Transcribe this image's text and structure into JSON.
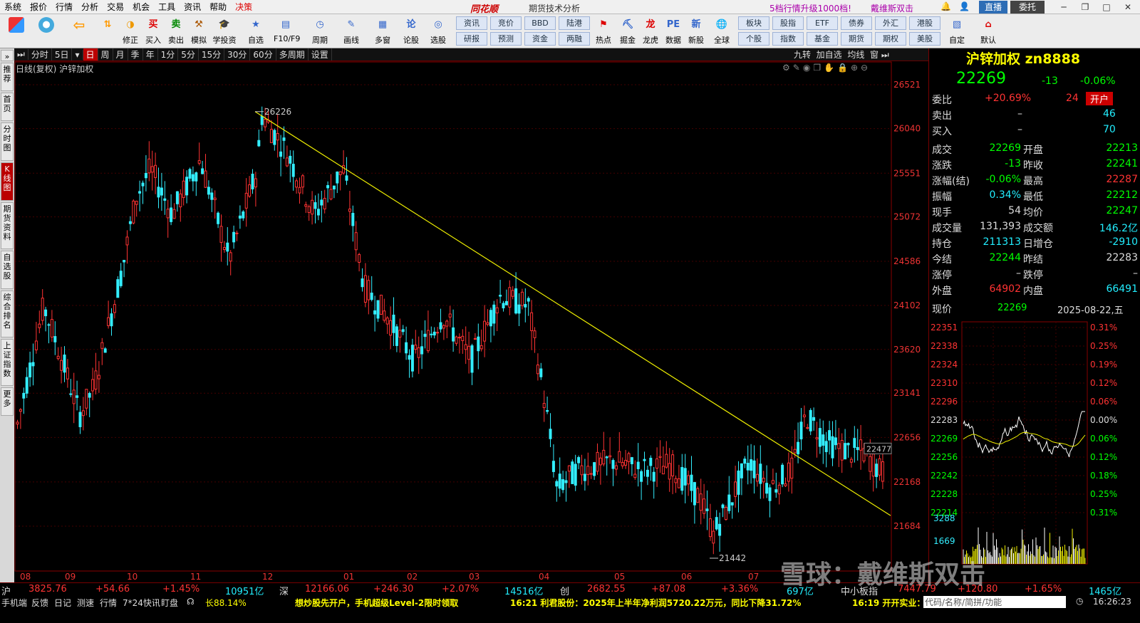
{
  "menu": {
    "items": [
      "系统",
      "报价",
      "行情",
      "分析",
      "交易",
      "机会",
      "工具",
      "资讯",
      "帮助",
      "决策"
    ],
    "brand": "同花顺",
    "brand_sub": "期货技术分析",
    "promo": "5档行情升级1000档!",
    "broker": "戴维斯双击",
    "live": "直播",
    "order": "委托"
  },
  "toolbar": {
    "buttons": [
      "修正",
      "买入",
      "卖出",
      "模拟",
      "学投资",
      "自选",
      "F10/F9",
      "周期",
      "画线",
      "多窗",
      "论股",
      "选股",
      "热点",
      "掘金",
      "龙虎",
      "数据",
      "新股",
      "全球",
      "自定",
      "默认"
    ],
    "small": [
      [
        "资讯",
        "研报"
      ],
      [
        "竞价",
        "预测"
      ],
      [
        "BBD",
        "资金"
      ],
      [
        "陆港",
        "两融"
      ],
      [
        "板块",
        "个股"
      ],
      [
        "股指",
        "指数"
      ],
      [
        "ETF",
        "基金"
      ],
      [
        "债券",
        "期货"
      ],
      [
        "外汇",
        "期权"
      ],
      [
        "港股",
        "美股"
      ]
    ]
  },
  "sidetabs": [
    "推荐",
    "首页",
    "分时图",
    "K线图",
    "期货资料",
    "自选股",
    "综合排名",
    "上证指数",
    "更多"
  ],
  "periods": [
    "分时",
    "5日",
    "日",
    "周",
    "月",
    "季",
    "年",
    "1分",
    "5分",
    "15分",
    "30分",
    "60分",
    "多周期",
    "设置"
  ],
  "right_tools": [
    "九转",
    "加自选",
    "均线",
    "窗"
  ],
  "chart": {
    "title_mode": "日线(复权)",
    "title_name": "沪锌加权",
    "price_ticks": [
      "26521",
      "26040",
      "25551",
      "25072",
      "24586",
      "24102",
      "23620",
      "23141",
      "22656",
      "22168",
      "21684"
    ],
    "months": [
      "08",
      "09",
      "10",
      "11",
      "12",
      "01",
      "02",
      "03",
      "04",
      "05",
      "06",
      "07"
    ],
    "high_label": "26226",
    "low_label": "21442",
    "last_label": "22477"
  },
  "chart_data": {
    "type": "candlestick",
    "ylim": [
      21200,
      26700
    ],
    "x": [
      "08",
      "09",
      "10",
      "11",
      "12",
      "01",
      "02",
      "03",
      "04",
      "05",
      "06",
      "07"
    ],
    "high": 26226,
    "low": 21442,
    "last": 22269,
    "trendline": [
      [
        26226,
        "12"
      ],
      [
        21800,
        "08-22"
      ]
    ]
  },
  "quote": {
    "name": "沪锌加权 zn8888",
    "price": "22269",
    "change": "-13",
    "pct": "-0.06%",
    "rows": [
      [
        "委比",
        "+20.69%",
        "24",
        "开户"
      ],
      [
        "卖出",
        "–",
        "46",
        ""
      ],
      [
        "买入",
        "–",
        "70",
        ""
      ]
    ],
    "stats": [
      [
        "成交",
        "22269",
        "开盘",
        "22213"
      ],
      [
        "涨跌",
        "-13",
        "昨收",
        "22241"
      ],
      [
        "涨幅(结)",
        "-0.06%",
        "最高",
        "22287"
      ],
      [
        "振幅",
        "0.34%",
        "最低",
        "22212"
      ],
      [
        "现手",
        "54",
        "均价",
        "22247"
      ],
      [
        "成交量",
        "131,393",
        "成交额",
        "146.2亿"
      ],
      [
        "持仓",
        "211313",
        "日增仓",
        "-2910"
      ],
      [
        "今结",
        "22244",
        "昨结",
        "22283"
      ],
      [
        "涨停",
        "–",
        "跌停",
        "–"
      ],
      [
        "外盘",
        "64902",
        "内盘",
        "66491"
      ]
    ],
    "mini_label": "现价",
    "mini_price": "22269",
    "mini_date": "2025-08-22,五",
    "mini_prices": [
      "22351",
      "22338",
      "22324",
      "22310",
      "22296",
      "22283",
      "22269",
      "22256",
      "22242",
      "22228",
      "22214"
    ],
    "mini_pcts": [
      "0.31%",
      "0.25%",
      "0.19%",
      "0.12%",
      "0.06%",
      "0.00%",
      "0.06%",
      "0.12%",
      "0.18%",
      "0.25%",
      "0.31%"
    ],
    "mini_vol": [
      "3288",
      "1669"
    ]
  },
  "status": {
    "sh": "沪",
    "sh_v": "3825.76",
    "sh_c": "+54.66",
    "sh_p": "+1.45%",
    "sh_a": "10951亿",
    "sz": "深",
    "sz_v": "12166.06",
    "sz_c": "+246.30",
    "sz_p": "+2.07%",
    "sz_a": "14516亿",
    "cy": "创",
    "cy_v": "2682.55",
    "cy_c": "+87.08",
    "cy_p": "+3.36%",
    "cy_a": "697亿",
    "zx": "中小板指",
    "zx_v": "7447.79",
    "zx_c": "+120.80",
    "zx_p": "+1.65%",
    "zx_a": "1465亿"
  },
  "bottom": {
    "items": [
      "手机端",
      "反馈",
      "日记",
      "测速",
      "行情",
      "7*24快讯",
      "盯盘"
    ],
    "long": "长88.14%",
    "news1": "想炒股先开户，手机超级Level-2限时领取",
    "news2": "16:21 利君股份：2025年上半年净利润5720.22万元，同比下降31.72%",
    "news3": "16:19 开开实业：",
    "search": "代码/名称/简拼/功能",
    "time": "16:26:23"
  },
  "watermark": "雪球：戴维斯双击"
}
